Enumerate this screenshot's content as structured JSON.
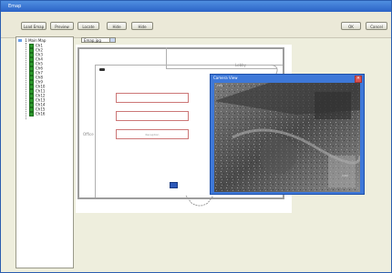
{
  "window": {
    "title": "Emap"
  },
  "toolbar": {
    "buttons": [
      {
        "label": "Load Emap"
      },
      {
        "label": "Preview"
      },
      {
        "label": "Locate"
      },
      {
        "label": "Hide"
      },
      {
        "label": "Hide"
      },
      {
        "label": "OK"
      },
      {
        "label": "Cancel"
      }
    ]
  },
  "map_select": {
    "value": "Emap.jpg"
  },
  "tree": {
    "root": "1 Main Map",
    "items": [
      "Ch1",
      "Ch2",
      "Ch3",
      "Ch4",
      "Ch5",
      "Ch6",
      "Ch7",
      "Ch8",
      "Ch9",
      "Ch10",
      "Ch11",
      "Ch12",
      "Ch13",
      "Ch14",
      "Ch15",
      "Ch16"
    ]
  },
  "plan": {
    "room_label": "Office",
    "room_label_2": "Lobby",
    "field_hint": "Reception"
  },
  "popup": {
    "title": "Camera View",
    "osd": "CH1",
    "osd2": "CAM"
  },
  "colors": {
    "titlebar": "#2b63c7",
    "popup": "#3e78d8",
    "tree_icon": "#2d9a2d"
  }
}
